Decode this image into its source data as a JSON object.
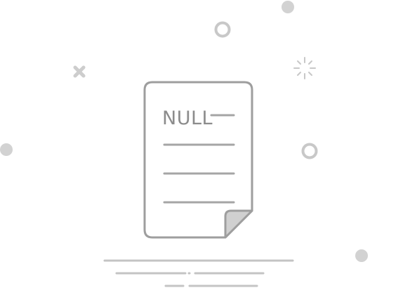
{
  "illustration": {
    "document_text": "NULL",
    "colors": {
      "stroke": "#9e9e9e",
      "light_stroke": "#c4c4c4",
      "fold_fill": "#d0d0d0",
      "text": "#8c8c8c",
      "background": "#ffffff"
    },
    "icons": [
      "empty-document-icon",
      "circle-dot",
      "ring",
      "cross-mark",
      "sparkle"
    ]
  }
}
